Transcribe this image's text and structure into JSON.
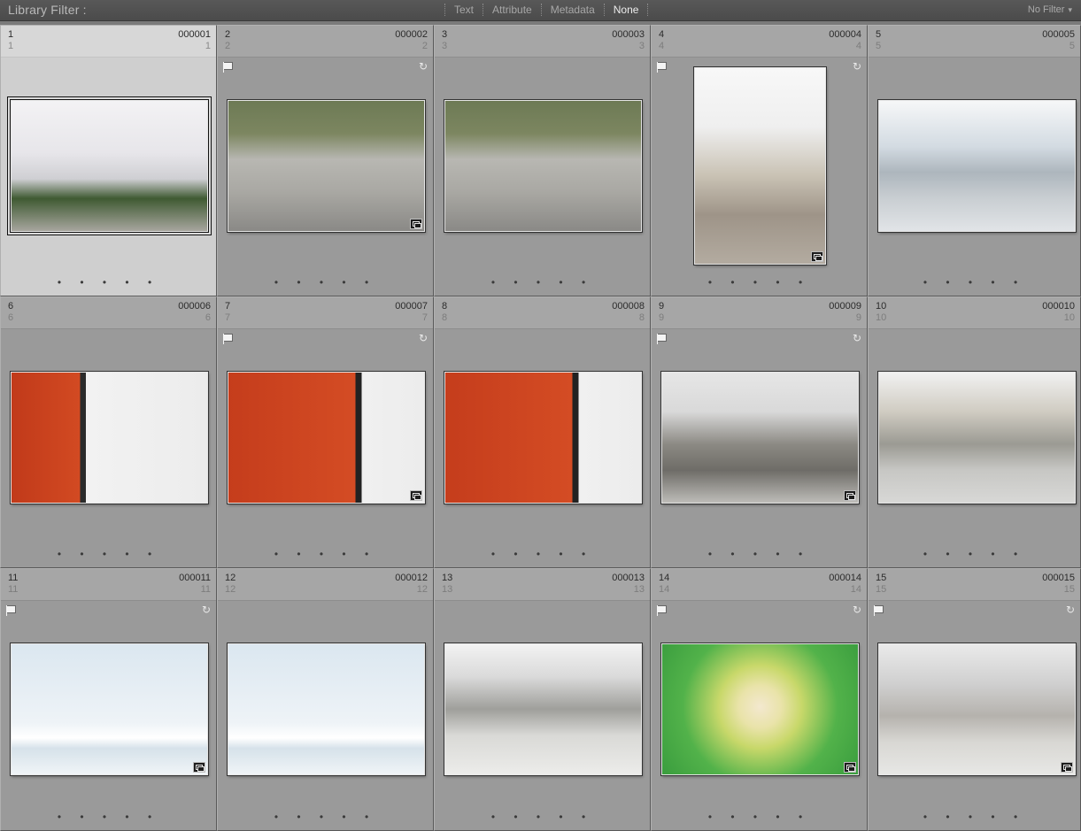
{
  "filter_bar": {
    "title": "Library Filter :",
    "options": [
      {
        "label": "Text",
        "active": false
      },
      {
        "label": "Attribute",
        "active": false
      },
      {
        "label": "Metadata",
        "active": false
      },
      {
        "label": "None",
        "active": true
      }
    ],
    "preset": "No Filter"
  },
  "cells": [
    {
      "index": "1",
      "index2": "1",
      "filename": "000001",
      "file_index": "1",
      "flag": false,
      "rotate": false,
      "badge": false,
      "orientation": "land",
      "selected": true,
      "photo": "sky-city"
    },
    {
      "index": "2",
      "index2": "2",
      "filename": "000002",
      "file_index": "2",
      "flag": true,
      "rotate": true,
      "badge": true,
      "orientation": "land",
      "selected": false,
      "photo": "plaza"
    },
    {
      "index": "3",
      "index2": "3",
      "filename": "000003",
      "file_index": "3",
      "flag": false,
      "rotate": false,
      "badge": false,
      "orientation": "land",
      "selected": false,
      "photo": "plaza"
    },
    {
      "index": "4",
      "index2": "4",
      "filename": "000004",
      "file_index": "4",
      "flag": true,
      "rotate": true,
      "badge": true,
      "orientation": "port",
      "selected": false,
      "photo": "pier"
    },
    {
      "index": "5",
      "index2": "5",
      "filename": "000005",
      "file_index": "5",
      "flag": false,
      "rotate": false,
      "badge": false,
      "orientation": "land",
      "selected": false,
      "photo": "blue-city"
    },
    {
      "index": "6",
      "index2": "6",
      "filename": "000006",
      "file_index": "6",
      "flag": false,
      "rotate": false,
      "badge": false,
      "orientation": "land",
      "selected": false,
      "photo": "red-wall"
    },
    {
      "index": "7",
      "index2": "7",
      "filename": "000007",
      "file_index": "7",
      "flag": true,
      "rotate": true,
      "badge": true,
      "orientation": "land",
      "selected": false,
      "photo": "red-wall2"
    },
    {
      "index": "8",
      "index2": "8",
      "filename": "000008",
      "file_index": "8",
      "flag": false,
      "rotate": false,
      "badge": false,
      "orientation": "land",
      "selected": false,
      "photo": "red-wall2"
    },
    {
      "index": "9",
      "index2": "9",
      "filename": "000009",
      "file_index": "9",
      "flag": true,
      "rotate": true,
      "badge": true,
      "orientation": "land",
      "selected": false,
      "photo": "street"
    },
    {
      "index": "10",
      "index2": "10",
      "filename": "000010",
      "file_index": "10",
      "flag": false,
      "rotate": false,
      "badge": false,
      "orientation": "land",
      "selected": false,
      "photo": "street2"
    },
    {
      "index": "11",
      "index2": "11",
      "filename": "000011",
      "file_index": "11",
      "flag": true,
      "rotate": true,
      "badge": true,
      "orientation": "land",
      "selected": false,
      "photo": "sky-feet"
    },
    {
      "index": "12",
      "index2": "12",
      "filename": "000012",
      "file_index": "12",
      "flag": false,
      "rotate": false,
      "badge": false,
      "orientation": "land",
      "selected": false,
      "photo": "sky-feet"
    },
    {
      "index": "13",
      "index2": "13",
      "filename": "000013",
      "file_index": "13",
      "flag": false,
      "rotate": false,
      "badge": false,
      "orientation": "land",
      "selected": false,
      "photo": "square"
    },
    {
      "index": "14",
      "index2": "14",
      "filename": "000014",
      "file_index": "14",
      "flag": true,
      "rotate": true,
      "badge": true,
      "orientation": "land",
      "selected": false,
      "photo": "green-blob"
    },
    {
      "index": "15",
      "index2": "15",
      "filename": "000015",
      "file_index": "15",
      "flag": true,
      "rotate": true,
      "badge": true,
      "orientation": "land",
      "selected": false,
      "photo": "square2"
    }
  ],
  "rating_dots": "• • • • •",
  "icons": {
    "flag": "pick-flag-icon",
    "rotate": "rotate-icon",
    "badge": "edited-badge-icon",
    "caret": "chevron-down-icon"
  }
}
